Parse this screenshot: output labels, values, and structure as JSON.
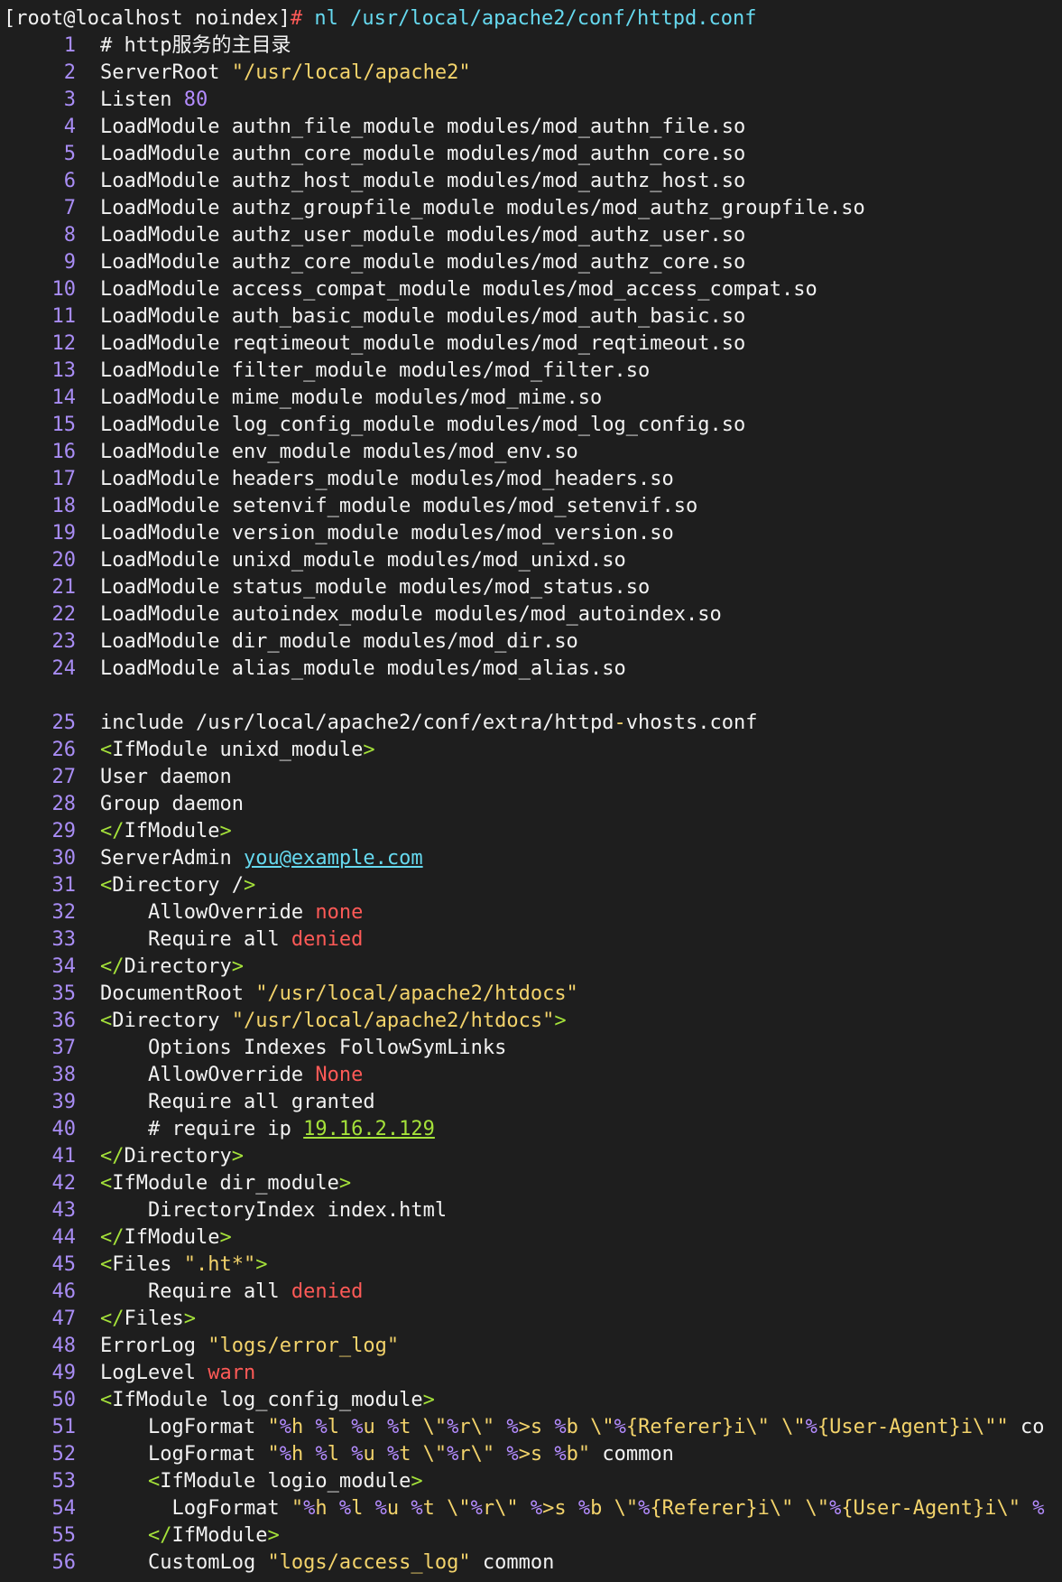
{
  "prompt": {
    "host": "[root@localhost noindex]",
    "symbol": "#",
    "command": "nl /usr/local/apache2/conf/httpd.conf"
  },
  "colors": {
    "background": "#1e1e1e",
    "text": "#f2f2f2",
    "line_number": "#a98df5",
    "string": "#f3d36b",
    "tag": "#a5e23a",
    "keyword_red": "#ff5a57",
    "link": "#66d9ef"
  },
  "lines": [
    {
      "n": "1",
      "t": [
        [
          "# http服务的主目录",
          ""
        ]
      ]
    },
    {
      "n": "2",
      "t": [
        [
          "ServerRoot ",
          ""
        ],
        [
          "\"/usr/local/apache2\"",
          "str"
        ]
      ]
    },
    {
      "n": "3",
      "t": [
        [
          "Listen ",
          ""
        ],
        [
          "80",
          "num"
        ]
      ]
    },
    {
      "n": "4",
      "t": [
        [
          "LoadModule authn_file_module modules/mod_authn_file.so",
          ""
        ]
      ]
    },
    {
      "n": "5",
      "t": [
        [
          "LoadModule authn_core_module modules/mod_authn_core.so",
          ""
        ]
      ]
    },
    {
      "n": "6",
      "t": [
        [
          "LoadModule authz_host_module modules/mod_authz_host.so",
          ""
        ]
      ]
    },
    {
      "n": "7",
      "t": [
        [
          "LoadModule authz_groupfile_module modules/mod_authz_groupfile.so",
          ""
        ]
      ]
    },
    {
      "n": "8",
      "t": [
        [
          "LoadModule authz_user_module modules/mod_authz_user.so",
          ""
        ]
      ]
    },
    {
      "n": "9",
      "t": [
        [
          "LoadModule authz_core_module modules/mod_authz_core.so",
          ""
        ]
      ]
    },
    {
      "n": "10",
      "t": [
        [
          "LoadModule access_compat_module modules/mod_access_compat.so",
          ""
        ]
      ]
    },
    {
      "n": "11",
      "t": [
        [
          "LoadModule auth_basic_module modules/mod_auth_basic.so",
          ""
        ]
      ]
    },
    {
      "n": "12",
      "t": [
        [
          "LoadModule reqtimeout_module modules/mod_reqtimeout.so",
          ""
        ]
      ]
    },
    {
      "n": "13",
      "t": [
        [
          "LoadModule filter_module modules/mod_filter.so",
          ""
        ]
      ]
    },
    {
      "n": "14",
      "t": [
        [
          "LoadModule mime_module modules/mod_mime.so",
          ""
        ]
      ]
    },
    {
      "n": "15",
      "t": [
        [
          "LoadModule log_config_module modules/mod_log_config.so",
          ""
        ]
      ]
    },
    {
      "n": "16",
      "t": [
        [
          "LoadModule env_module modules/mod_env.so",
          ""
        ]
      ]
    },
    {
      "n": "17",
      "t": [
        [
          "LoadModule headers_module modules/mod_headers.so",
          ""
        ]
      ]
    },
    {
      "n": "18",
      "t": [
        [
          "LoadModule setenvif_module modules/mod_setenvif.so",
          ""
        ]
      ]
    },
    {
      "n": "19",
      "t": [
        [
          "LoadModule version_module modules/mod_version.so",
          ""
        ]
      ]
    },
    {
      "n": "20",
      "t": [
        [
          "LoadModule unixd_module modules/mod_unixd.so",
          ""
        ]
      ]
    },
    {
      "n": "21",
      "t": [
        [
          "LoadModule status_module modules/mod_status.so",
          ""
        ]
      ]
    },
    {
      "n": "22",
      "t": [
        [
          "LoadModule autoindex_module modules/mod_autoindex.so",
          ""
        ]
      ]
    },
    {
      "n": "23",
      "t": [
        [
          "LoadModule dir_module modules/mod_dir.so",
          ""
        ]
      ]
    },
    {
      "n": "24",
      "t": [
        [
          "LoadModule alias_module modules/mod_alias.so",
          ""
        ]
      ]
    },
    {
      "n": "",
      "t": []
    },
    {
      "n": "25",
      "t": [
        [
          "include /usr/local/apache2/conf/extra/httpd",
          ""
        ],
        [
          "-",
          "hy"
        ],
        [
          "vhosts.conf",
          ""
        ]
      ]
    },
    {
      "n": "26",
      "t": [
        [
          "<",
          "tag"
        ],
        [
          "IfModule unixd_module",
          ""
        ],
        [
          ">",
          "tag"
        ]
      ]
    },
    {
      "n": "27",
      "t": [
        [
          "User daemon",
          ""
        ]
      ]
    },
    {
      "n": "28",
      "t": [
        [
          "Group daemon",
          ""
        ]
      ]
    },
    {
      "n": "29",
      "t": [
        [
          "</",
          "tag"
        ],
        [
          "IfModule",
          ""
        ],
        [
          ">",
          "tag"
        ]
      ]
    },
    {
      "n": "30",
      "t": [
        [
          "ServerAdmin ",
          ""
        ],
        [
          "you@example.com",
          "link"
        ]
      ]
    },
    {
      "n": "31",
      "t": [
        [
          "<",
          "tag"
        ],
        [
          "Directory /",
          ""
        ],
        [
          ">",
          "tag"
        ]
      ]
    },
    {
      "n": "32",
      "t": [
        [
          "    AllowOverride ",
          ""
        ],
        [
          "none",
          "red"
        ]
      ]
    },
    {
      "n": "33",
      "t": [
        [
          "    Require all ",
          ""
        ],
        [
          "denied",
          "red"
        ]
      ]
    },
    {
      "n": "34",
      "t": [
        [
          "</",
          "tag"
        ],
        [
          "Directory",
          ""
        ],
        [
          ">",
          "tag"
        ]
      ]
    },
    {
      "n": "35",
      "t": [
        [
          "DocumentRoot ",
          ""
        ],
        [
          "\"/usr/local/apache2/htdocs\"",
          "str"
        ]
      ]
    },
    {
      "n": "36",
      "t": [
        [
          "<",
          "tag"
        ],
        [
          "Directory ",
          ""
        ],
        [
          "\"/usr/local/apache2/htdocs\"",
          "str"
        ],
        [
          ">",
          "tag"
        ]
      ]
    },
    {
      "n": "37",
      "t": [
        [
          "    Options Indexes FollowSymLinks",
          ""
        ]
      ]
    },
    {
      "n": "38",
      "t": [
        [
          "    AllowOverride ",
          ""
        ],
        [
          "None",
          "red"
        ]
      ]
    },
    {
      "n": "39",
      "t": [
        [
          "    Require all granted",
          ""
        ]
      ]
    },
    {
      "n": "40",
      "t": [
        [
          "    # require ip ",
          ""
        ],
        [
          "19.16.2.129",
          "ip"
        ]
      ]
    },
    {
      "n": "41",
      "t": [
        [
          "</",
          "tag"
        ],
        [
          "Directory",
          ""
        ],
        [
          ">",
          "tag"
        ]
      ]
    },
    {
      "n": "42",
      "t": [
        [
          "<",
          "tag"
        ],
        [
          "IfModule dir_module",
          ""
        ],
        [
          ">",
          "tag"
        ]
      ]
    },
    {
      "n": "43",
      "t": [
        [
          "    DirectoryIndex index.html",
          ""
        ]
      ]
    },
    {
      "n": "44",
      "t": [
        [
          "</",
          "tag"
        ],
        [
          "IfModule",
          ""
        ],
        [
          ">",
          "tag"
        ]
      ]
    },
    {
      "n": "45",
      "t": [
        [
          "<",
          "tag"
        ],
        [
          "Files ",
          ""
        ],
        [
          "\".ht*\"",
          "str"
        ],
        [
          ">",
          "tag"
        ]
      ]
    },
    {
      "n": "46",
      "t": [
        [
          "    Require all ",
          ""
        ],
        [
          "denied",
          "red"
        ]
      ]
    },
    {
      "n": "47",
      "t": [
        [
          "</",
          "tag"
        ],
        [
          "Files",
          ""
        ],
        [
          ">",
          "tag"
        ]
      ]
    },
    {
      "n": "48",
      "t": [
        [
          "ErrorLog ",
          ""
        ],
        [
          "\"logs/error_log\"",
          "str"
        ]
      ]
    },
    {
      "n": "49",
      "t": [
        [
          "LogLevel ",
          ""
        ],
        [
          "warn",
          "red"
        ]
      ]
    },
    {
      "n": "50",
      "t": [
        [
          "<",
          "tag"
        ],
        [
          "IfModule log_config_module",
          ""
        ],
        [
          ">",
          "tag"
        ]
      ]
    },
    {
      "n": "51",
      "t": [
        [
          "    LogFormat ",
          ""
        ],
        [
          "\"",
          "str"
        ],
        [
          "%",
          "pct"
        ],
        [
          "h ",
          "str"
        ],
        [
          "%",
          "pct"
        ],
        [
          "l ",
          "str"
        ],
        [
          "%",
          "pct"
        ],
        [
          "u ",
          "str"
        ],
        [
          "%",
          "pct"
        ],
        [
          "t \\\"",
          "str"
        ],
        [
          "%",
          "pct"
        ],
        [
          "r\\\" ",
          "str"
        ],
        [
          "%",
          "pct"
        ],
        [
          ">s ",
          "str"
        ],
        [
          "%",
          "pct"
        ],
        [
          "b \\\"",
          "str"
        ],
        [
          "%",
          "pct"
        ],
        [
          "{Referer}i\\\" \\\"",
          "str"
        ],
        [
          "%",
          "pct"
        ],
        [
          "{User-Agent}i\\\"\"",
          "str"
        ],
        [
          " co",
          ""
        ]
      ]
    },
    {
      "n": "52",
      "t": [
        [
          "    LogFormat ",
          ""
        ],
        [
          "\"",
          "str"
        ],
        [
          "%",
          "pct"
        ],
        [
          "h ",
          "str"
        ],
        [
          "%",
          "pct"
        ],
        [
          "l ",
          "str"
        ],
        [
          "%",
          "pct"
        ],
        [
          "u ",
          "str"
        ],
        [
          "%",
          "pct"
        ],
        [
          "t \\\"",
          "str"
        ],
        [
          "%",
          "pct"
        ],
        [
          "r\\\" ",
          "str"
        ],
        [
          "%",
          "pct"
        ],
        [
          ">s ",
          "str"
        ],
        [
          "%",
          "pct"
        ],
        [
          "b\"",
          "str"
        ],
        [
          " common",
          ""
        ]
      ]
    },
    {
      "n": "53",
      "t": [
        [
          "    <",
          "tag"
        ],
        [
          "IfModule logio_module",
          ""
        ],
        [
          ">",
          "tag"
        ]
      ]
    },
    {
      "n": "54",
      "t": [
        [
          "      LogFormat ",
          ""
        ],
        [
          "\"",
          "str"
        ],
        [
          "%",
          "pct"
        ],
        [
          "h ",
          "str"
        ],
        [
          "%",
          "pct"
        ],
        [
          "l ",
          "str"
        ],
        [
          "%",
          "pct"
        ],
        [
          "u ",
          "str"
        ],
        [
          "%",
          "pct"
        ],
        [
          "t \\\"",
          "str"
        ],
        [
          "%",
          "pct"
        ],
        [
          "r\\\" ",
          "str"
        ],
        [
          "%",
          "pct"
        ],
        [
          ">s ",
          "str"
        ],
        [
          "%",
          "pct"
        ],
        [
          "b \\\"",
          "str"
        ],
        [
          "%",
          "pct"
        ],
        [
          "{Referer}i\\\" \\\"",
          "str"
        ],
        [
          "%",
          "pct"
        ],
        [
          "{User-Agent}i\\\" ",
          "str"
        ],
        [
          "%",
          "pct"
        ]
      ]
    },
    {
      "n": "55",
      "t": [
        [
          "    </",
          "tag"
        ],
        [
          "IfModule",
          ""
        ],
        [
          ">",
          "tag"
        ]
      ]
    },
    {
      "n": "56",
      "t": [
        [
          "    CustomLog ",
          ""
        ],
        [
          "\"logs/access_log\"",
          "str"
        ],
        [
          " common",
          ""
        ]
      ]
    }
  ]
}
